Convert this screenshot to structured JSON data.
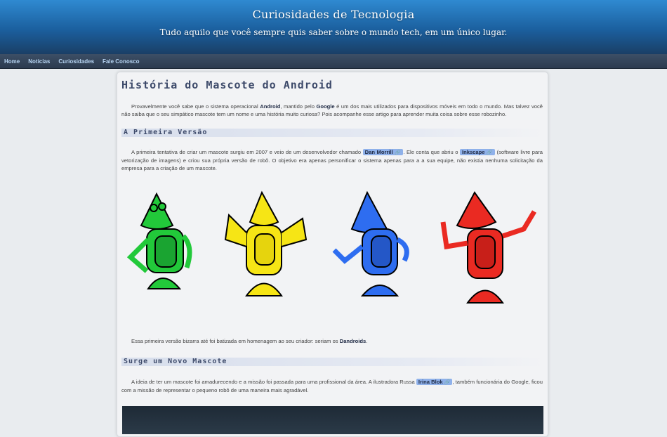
{
  "header": {
    "title": "Curiosidades de Tecnologia",
    "subtitle": "Tudo aquilo que você sempre quis saber sobre o mundo tech, em um único lugar."
  },
  "nav": {
    "items": [
      "Home",
      "Notícias",
      "Curiosidades",
      "Fale Conosco"
    ]
  },
  "article": {
    "title": "História do Mascote do Android",
    "intro": {
      "t1": "Provavelmente você sabe que o sistema operacional ",
      "b1": "Android",
      "t2": ", mantido pelo ",
      "b2": "Google",
      "t3": " é um dos mais utilizados para dispositivos móveis em todo o mundo. Mas talvez você não saiba que o seu simpático mascote tem um nome e uma história muito curiosa? Pois acompanhe esse artigo para aprender muita coisa sobre esse robozinho."
    },
    "section1": {
      "heading": "A Primeira Versão",
      "p1": {
        "t1": "A primeira tentativa de criar um mascote surgiu em 2007 e veio de um desenvolvedor chamado ",
        "link1": "Dan Morrill",
        "t2": ". Ele conta que abriu o ",
        "link2": "Inkscape",
        "t3": " (software livre para vetorização de imagens) e criou sua própria versão de robô. O objetivo era apenas personificar o sistema apenas para a a sua equipe, não existia nenhuma solicitação da empresa para a criação de um mascote."
      },
      "p2": {
        "t1": "Essa primeira versão bizarra até foi batizada em homenagem ao seu criador: seriam os ",
        "b1": "Dandroids",
        "t2": "."
      }
    },
    "section2": {
      "heading": "Surge um Novo Mascote",
      "p1": {
        "t1": "A ideia de ter um mascote foi amadurecendo e a missão foi passada para uma profissional da área. A ilustradora Russa ",
        "link1": "Irina Blok",
        "t2": ", também funcionária do Google, ficou com a missão de representar o pequeno robô de uma maneira mais agradável."
      }
    }
  },
  "colors": {
    "header_top": "#2f8ad1",
    "nav_bg": "#2c3b4f",
    "link_bg": "#8fb1ea",
    "robot_green": "#22c93a",
    "robot_yellow": "#f6e515",
    "robot_blue": "#2e6df0",
    "robot_red": "#ea2a22"
  },
  "icons": {
    "external_link": "external-link-icon"
  }
}
